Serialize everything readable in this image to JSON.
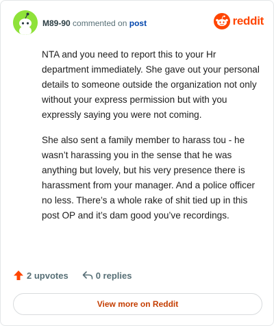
{
  "comment": {
    "username": "M89-90",
    "action_text": "commented on",
    "post_link": "post",
    "paragraphs": [
      "NTA and you need to report this to your Hr department immediately. She gave out your personal details to someone outside the organization not only without your express permission but with you expressly saying you were not coming.",
      "She also sent a family member to harass tou - he wasn’t harassing you in the sense that he was anything but lovely, but his very presence there is harassment from your manager. And a police officer no less. There’s a whole rake of shit tied up in this post OP and it’s dam good you’ve recordings."
    ]
  },
  "brand": {
    "wordmark": "reddit",
    "icon": "reddit-logo-icon",
    "color": "#ff4500"
  },
  "avatar": {
    "icon": "snoo-avatar-icon",
    "color": "#8fe23a"
  },
  "actions": {
    "upvotes": "2 upvotes",
    "upvote_icon": "upvote-arrow-icon",
    "replies": "0 replies",
    "reply_icon": "reply-arrow-icon"
  },
  "footer": {
    "view_more": "View more on Reddit"
  }
}
